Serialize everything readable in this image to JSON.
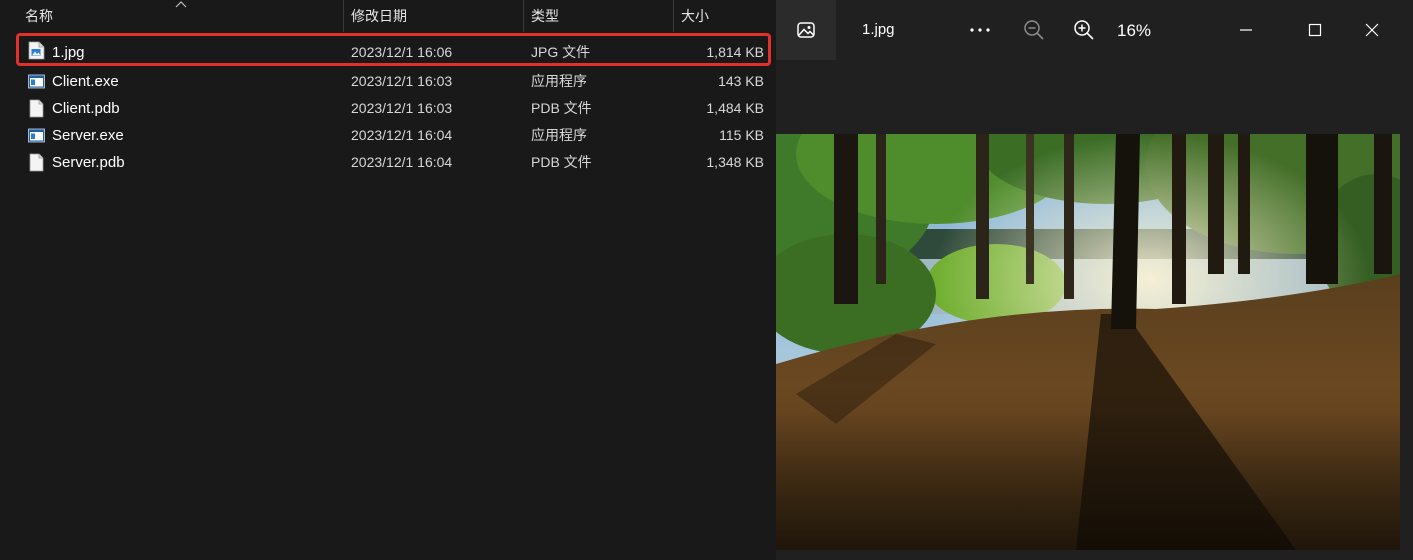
{
  "explorer": {
    "columns": {
      "name": "名称",
      "modified": "修改日期",
      "type": "类型",
      "size": "大小"
    },
    "files": [
      {
        "name": "1.jpg",
        "modified": "2023/12/1 16:06",
        "type": "JPG 文件",
        "size": "1,814 KB",
        "icon": "jpg-file-icon",
        "selected": true
      },
      {
        "name": "Client.exe",
        "modified": "2023/12/1 16:03",
        "type": "应用程序",
        "size": "143 KB",
        "icon": "exe-file-icon"
      },
      {
        "name": "Client.pdb",
        "modified": "2023/12/1 16:03",
        "type": "PDB 文件",
        "size": "1,484 KB",
        "icon": "blank-file-icon"
      },
      {
        "name": "Server.exe",
        "modified": "2023/12/1 16:04",
        "type": "应用程序",
        "size": "115 KB",
        "icon": "exe-file-icon"
      },
      {
        "name": "Server.pdb",
        "modified": "2023/12/1 16:04",
        "type": "PDB 文件",
        "size": "1,348 KB",
        "icon": "blank-file-icon"
      }
    ],
    "highlight_color": "#e2302b"
  },
  "viewer": {
    "file_name": "1.jpg",
    "zoom": "16%",
    "toolbar_icons": [
      "photos-app-icon",
      "more-icon",
      "zoom-out-icon",
      "zoom-in-icon"
    ],
    "window_controls": [
      "minimize-icon",
      "maximize-icon",
      "close-icon"
    ]
  }
}
